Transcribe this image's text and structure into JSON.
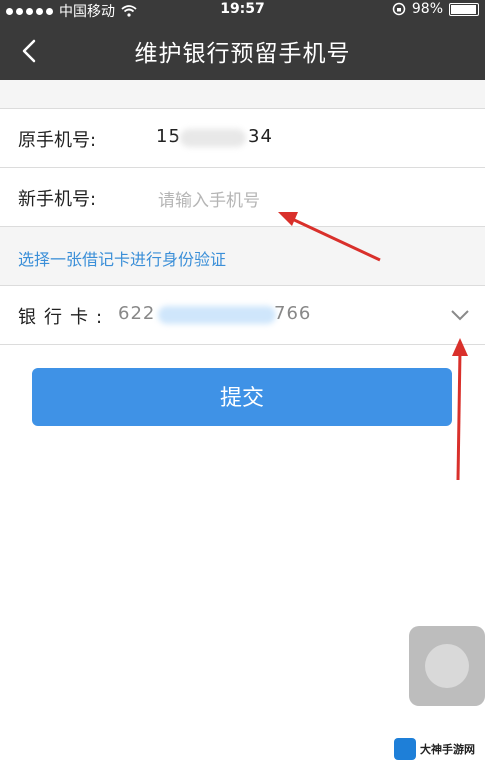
{
  "status": {
    "carrier": "中国移动",
    "time": "19:57",
    "battery": "98%"
  },
  "nav": {
    "title": "维护银行预留手机号"
  },
  "form": {
    "original_label": "原手机号:",
    "original_value_start": "15",
    "original_value_end": "34",
    "new_label": "新手机号:",
    "new_placeholder": "请输入手机号",
    "hint": "选择一张借记卡进行身份验证",
    "card_label": "银行卡:",
    "card_value_start": "622",
    "card_value_end": "766",
    "submit": "提交"
  },
  "watermark": {
    "text": "大神手游网"
  },
  "colors": {
    "bar": "#3a3a3a",
    "accent": "#3f92e6",
    "link": "#3b8fd8",
    "arrow": "#d9302b"
  }
}
